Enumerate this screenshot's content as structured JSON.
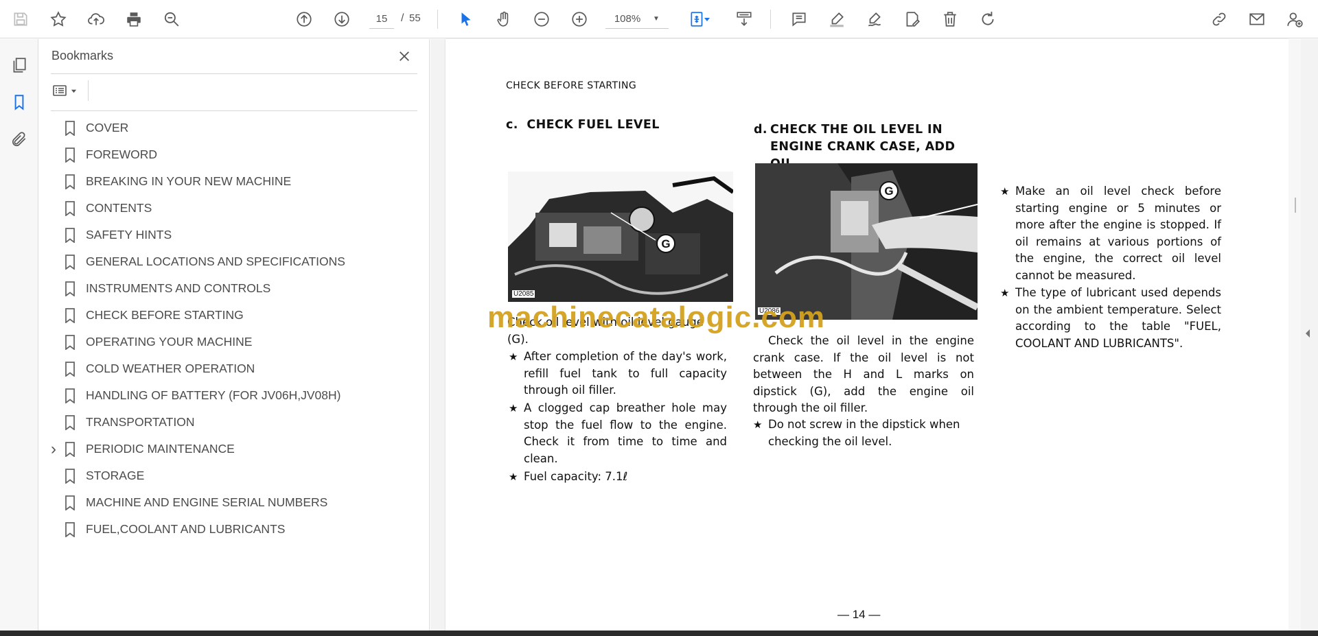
{
  "toolbar": {
    "page_current": "15",
    "page_separator": "/",
    "page_total": "55",
    "zoom": "108%"
  },
  "panel": {
    "title": "Bookmarks"
  },
  "bookmarks": [
    {
      "label": "COVER",
      "expandable": false
    },
    {
      "label": "FOREWORD",
      "expandable": false
    },
    {
      "label": "BREAKING IN YOUR NEW MACHINE",
      "expandable": false
    },
    {
      "label": "CONTENTS",
      "expandable": false
    },
    {
      "label": "SAFETY HINTS",
      "expandable": false
    },
    {
      "label": "GENERAL LOCATIONS AND SPECIFICATIONS",
      "expandable": false
    },
    {
      "label": "INSTRUMENTS AND CONTROLS",
      "expandable": false
    },
    {
      "label": "CHECK BEFORE STARTING",
      "expandable": false
    },
    {
      "label": "OPERATING YOUR MACHINE",
      "expandable": false
    },
    {
      "label": "COLD WEATHER OPERATION",
      "expandable": false
    },
    {
      "label": "HANDLING OF BATTERY (FOR JV06H,JV08H)",
      "expandable": false
    },
    {
      "label": "TRANSPORTATION",
      "expandable": false
    },
    {
      "label": "PERIODIC MAINTENANCE",
      "expandable": true
    },
    {
      "label": "STORAGE",
      "expandable": false
    },
    {
      "label": "MACHINE AND ENGINE SERIAL NUMBERS",
      "expandable": false
    },
    {
      "label": "FUEL,COOLANT AND LUBRICANTS",
      "expandable": false
    }
  ],
  "document": {
    "section_header": "CHECK BEFORE STARTING",
    "col1": {
      "title_prefix": "c.",
      "title": "CHECK FUEL LEVEL",
      "photo_caption": "U2085",
      "photo_marker": "G",
      "intro_line1": "Check oil level with oil level gauge",
      "intro_line2": "(G).",
      "bullets": [
        "After completion of the day's work, refill fuel tank to full capacity through oil filler.",
        "A clogged cap breather hole may stop the fuel flow to the engine. Check it from time to time and clean.",
        "Fuel capacity: 7.1ℓ"
      ]
    },
    "col2": {
      "title_prefix": "d.",
      "title_line1": "CHECK THE OIL LEVEL IN",
      "title_line2": "ENGINE CRANK CASE, ADD OIL",
      "photo_caption": "U2086",
      "photo_marker": "G",
      "paragraph": "Check the oil level in the engine crank case. If the oil level is not between the H and L marks on dipstick (G), add the engine oil through the oil filler.",
      "bullets": [
        "Do not screw in the dipstick when checking the oil level."
      ]
    },
    "col3": {
      "bullets": [
        "Make an oil level check before starting engine or 5 minutes or more after the engine is stopped. If oil remains at various portions of the engine, the correct oil level cannot be measured.",
        "The type of lubricant used depends on the ambient temperature. Select according to the table \"FUEL, COOLANT AND LUBRICANTS\"."
      ]
    },
    "page_number": "— 14 —",
    "watermark": "machinecatalogic.com"
  },
  "colors": {
    "accent": "#1a73e8",
    "watermark": "#d3a21f",
    "icon": "#5a5a5a"
  }
}
